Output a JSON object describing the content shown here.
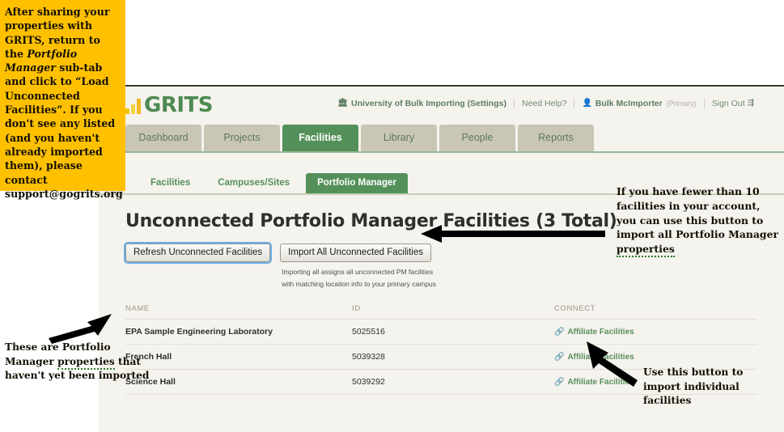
{
  "app": {
    "logo_text": "GRITS",
    "header_nav": [
      {
        "name": "organization",
        "icon": "bank-icon",
        "label": "University of Bulk Importing (Settings)",
        "bold": true
      },
      {
        "name": "need-help",
        "icon": "",
        "label": "Need Help?",
        "bold": false
      },
      {
        "name": "user",
        "icon": "user-icon",
        "label": "Bulk McImporter",
        "bold": true,
        "tag": "(Primary)"
      },
      {
        "name": "sign-out",
        "icon": "",
        "label": "Sign Out",
        "bold": false,
        "icon_after": "sign-out-icon"
      }
    ],
    "main_tabs": [
      {
        "label": "Dashboard",
        "active": false
      },
      {
        "label": "Projects",
        "active": false
      },
      {
        "label": "Facilities",
        "active": true
      },
      {
        "label": "Library",
        "active": false
      },
      {
        "label": "People",
        "active": false
      },
      {
        "label": "Reports",
        "active": false
      }
    ],
    "sub_tabs": [
      {
        "label": "Facilities",
        "active": false
      },
      {
        "label": "Campuses/Sites",
        "active": false
      },
      {
        "label": "Portfolio Manager",
        "active": true
      }
    ]
  },
  "page": {
    "title": "Unconnected Portfolio Manager Facilities (3 Total)",
    "refresh_button": "Refresh Unconnected Facilities",
    "import_all_button": "Import All Unconnected Facilities",
    "import_helper_line1": "Importing all assigns all unconnected PM facilities",
    "import_helper_line2": "with matching location info to your primary campus"
  },
  "table": {
    "headers": [
      "NAME",
      "ID",
      "CONNECT"
    ],
    "rows": [
      {
        "name": "EPA Sample Engineering Laboratory",
        "id": "5025516",
        "connect": "Affiliate Facilities"
      },
      {
        "name": "French Hall",
        "id": "5039328",
        "connect": "Affiliate Facilities"
      },
      {
        "name": "Science Hall",
        "id": "5039292",
        "connect": "Affiliate Facilities"
      }
    ]
  },
  "annotations": {
    "top_left_part1": "After sharing your properties with GRITS, return to the ",
    "top_left_italic": "Portfolio Manager",
    "top_left_part2": " sub-tab and click to “Load Unconnected Facilities”. If you don't see any listed (and you haven't already imported them), please contact support@gogrits.org",
    "right_part1": "If you have fewer than 10 facilities in your account, you can use this button to import all Portfolio Manager ",
    "right_spell": "properties",
    "bottom_left_part1": "These are Portfolio Manager ",
    "bottom_left_spell": "properties",
    "bottom_left_part2": " that haven't yet been imported",
    "bottom_right": "Use this button to import individual facilities"
  },
  "colors": {
    "brand_green": "#54915a",
    "logo_yellow": "#f0b823",
    "annotation_highlight": "#ffc000",
    "app_background": "#f5f3ee",
    "tab_inactive": "#cac6b5"
  }
}
